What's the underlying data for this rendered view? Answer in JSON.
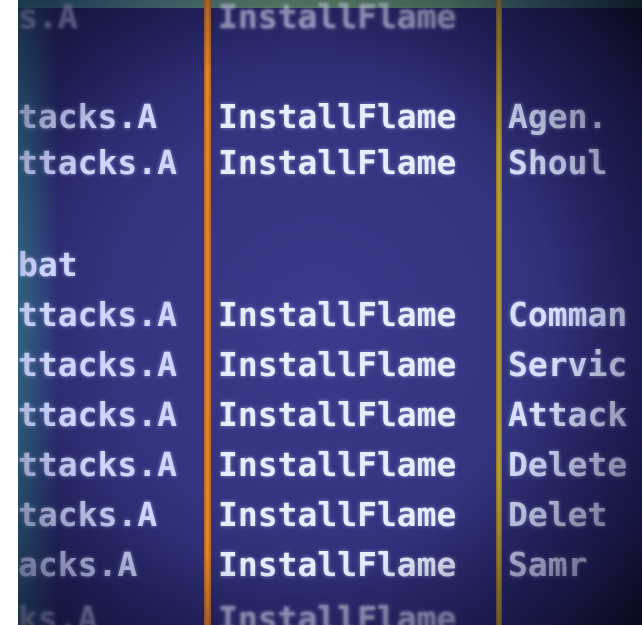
{
  "rows": [
    {
      "c1": "s.A",
      "c2": "InstallFlame",
      "c3": ""
    },
    {
      "c1": "tacks.A",
      "c2": "InstallFlame",
      "c3": "Agen."
    },
    {
      "c1": "ttacks.A",
      "c2": "InstallFlame",
      "c3": "Shoul"
    },
    {
      "c1": "",
      "c2": "",
      "c3": ""
    },
    {
      "c1": "bat",
      "c2": "",
      "c3": ""
    },
    {
      "c1": "ttacks.A",
      "c2": "InstallFlame",
      "c3": "Comman"
    },
    {
      "c1": "ttacks.A",
      "c2": "InstallFlame",
      "c3": "Servic"
    },
    {
      "c1": "ttacks.A",
      "c2": "InstallFlame",
      "c3": "Attack"
    },
    {
      "c1": "ttacks.A",
      "c2": "InstallFlame",
      "c3": "Delete"
    },
    {
      "c1": "tacks.A",
      "c2": "InstallFlame",
      "c3": "Delet"
    },
    {
      "c1": "acks.A",
      "c2": "InstallFlame",
      "c3": "Samr"
    },
    {
      "c1": "ks.A",
      "c2": "InstallFlame",
      "c3": ""
    }
  ]
}
